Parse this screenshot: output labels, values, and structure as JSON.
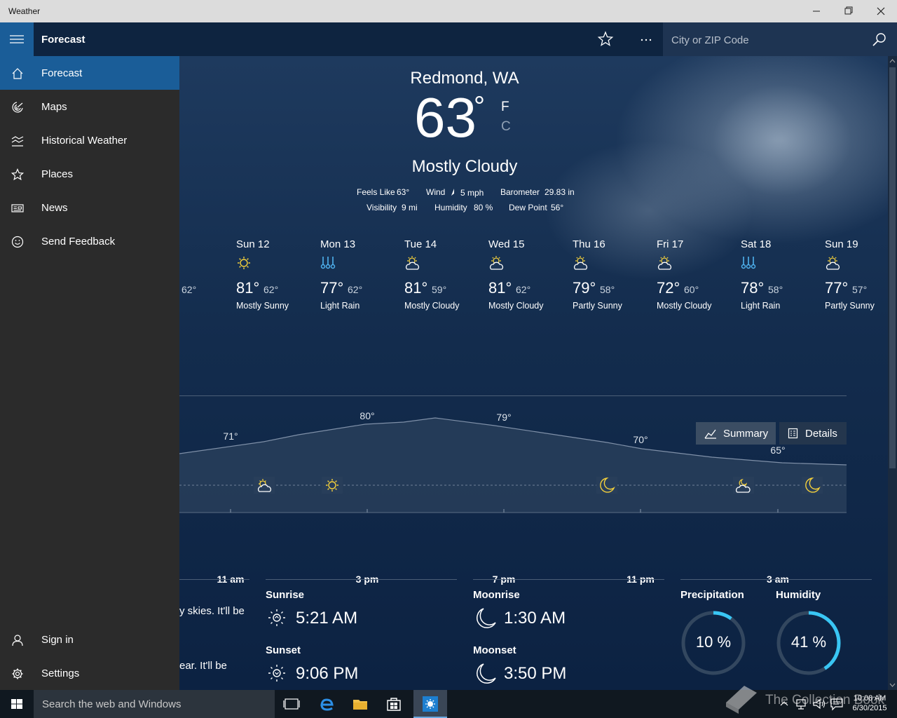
{
  "window": {
    "title": "Weather"
  },
  "appbar": {
    "title": "Forecast",
    "search_placeholder": "City or ZIP Code"
  },
  "sidebar": {
    "items": [
      {
        "label": "Forecast",
        "icon": "home-icon"
      },
      {
        "label": "Maps",
        "icon": "radar-icon"
      },
      {
        "label": "Historical Weather",
        "icon": "chart-icon"
      },
      {
        "label": "Places",
        "icon": "star-icon"
      },
      {
        "label": "News",
        "icon": "news-icon"
      },
      {
        "label": "Send Feedback",
        "icon": "smile-icon"
      }
    ],
    "bottom": [
      {
        "label": "Sign in",
        "icon": "person-icon"
      },
      {
        "label": "Settings",
        "icon": "gear-icon"
      }
    ]
  },
  "current": {
    "location": "Redmond, WA",
    "temp": "63",
    "deg": "°",
    "unit_f": "F",
    "unit_c": "C",
    "condition": "Mostly Cloudy",
    "feels_label": "Feels Like",
    "feels_value": "63°",
    "wind_label": "Wind",
    "wind_value": "5 mph",
    "barometer_label": "Barometer",
    "barometer_value": "29.83 in",
    "visibility_label": "Visibility",
    "visibility_value": "9 mi",
    "humidity_label": "Humidity",
    "humidity_value": "80 %",
    "dewpoint_label": "Dew Point",
    "dewpoint_value": "56°"
  },
  "daily": {
    "partial_low": "62°",
    "days": [
      {
        "name": "Sun 12",
        "hi": "81°",
        "lo": "62°",
        "cond": "Mostly Sunny",
        "icon": "sun-icon"
      },
      {
        "name": "Mon 13",
        "hi": "77°",
        "lo": "62°",
        "cond": "Light Rain",
        "icon": "rain-icon"
      },
      {
        "name": "Tue 14",
        "hi": "81°",
        "lo": "59°",
        "cond": "Mostly Cloudy",
        "icon": "partly-cloudy-icon"
      },
      {
        "name": "Wed 15",
        "hi": "81°",
        "lo": "62°",
        "cond": "Mostly Cloudy",
        "icon": "partly-cloudy-icon"
      },
      {
        "name": "Thu 16",
        "hi": "79°",
        "lo": "58°",
        "cond": "Partly Sunny",
        "icon": "partly-cloudy-icon"
      },
      {
        "name": "Fri 17",
        "hi": "72°",
        "lo": "60°",
        "cond": "Mostly Cloudy",
        "icon": "partly-cloudy-icon"
      },
      {
        "name": "Sat 18",
        "hi": "78°",
        "lo": "58°",
        "cond": "Light Rain",
        "icon": "rain-icon"
      },
      {
        "name": "Sun 19",
        "hi": "77°",
        "lo": "57°",
        "cond": "Partly Sunny",
        "icon": "partly-cloudy-icon"
      }
    ]
  },
  "tabs": {
    "summary": "Summary",
    "details": "Details"
  },
  "hourly": {
    "temp_labels": [
      "71°",
      "80°",
      "79°",
      "70°",
      "65°"
    ],
    "time_labels": [
      "11 am",
      "3 pm",
      "7 pm",
      "11 pm",
      "3 am"
    ],
    "icons": [
      "partly-cloudy-icon",
      "sun-icon",
      "moon-icon",
      "partly-cloudy-night-icon",
      "moon-icon"
    ]
  },
  "details": {
    "summary_line1": "y skies. It'll be",
    "summary_line2": "ear. It'll be",
    "sunrise_label": "Sunrise",
    "sunrise_time": "5:21 AM",
    "sunset_label": "Sunset",
    "sunset_time": "9:06 PM",
    "moonrise_label": "Moonrise",
    "moonrise_time": "1:30 AM",
    "moonset_label": "Moonset",
    "moonset_time": "3:50 PM",
    "precip_label": "Precipitation",
    "precip_value": "10 %",
    "precip_fraction": 0.1,
    "humidity_label": "Humidity",
    "humidity_value": "41 %",
    "humidity_fraction": 0.41
  },
  "taskbar": {
    "search_placeholder": "Search the web and Windows",
    "time": "10:08 AM",
    "date": "6/30/2015",
    "watermark": "The Collection Book"
  },
  "colors": {
    "accent": "#1a5d98",
    "sun": "#f5d13b",
    "rain": "#4fb3f0",
    "ring": "#39c6f4"
  }
}
